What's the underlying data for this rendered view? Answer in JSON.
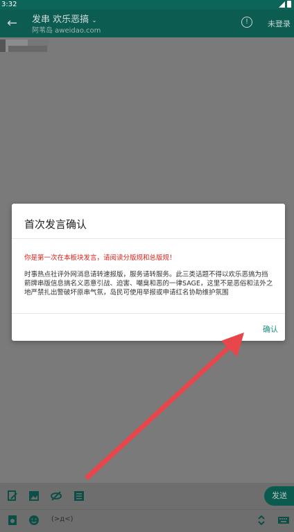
{
  "status_bar": {
    "time": "3:32"
  },
  "toolbar": {
    "title": "发串 欢乐恶搞",
    "subtitle": "阿苇岛 aweidao.com",
    "login_label": "未登录"
  },
  "dialog": {
    "title": "首次发言确认",
    "warning": "你是第一次在本板块发言，请阅读分版规和总版规！",
    "body": "时事热点社评外网消息请转速报版，服务请转服务。此三类话题不得以欢乐恶搞为挡箭牌串版信息搞名义恶意引战、迫害、嘲臭和恶的一律SAGE，这里不是恶俗和法外之地严禁扎出警破坏原串气氛，岛民可使用举报或申请红名协助维护氛围",
    "confirm_label": "确认"
  },
  "bottom": {
    "send_label": "发送",
    "kaomoji_label": "(>д<)"
  },
  "colors": {
    "statusbar": "#0d6458",
    "toolbar": "#0c5c51",
    "accent": "#1a8c7d",
    "warning": "#e0201a",
    "arrow": "#e8464a"
  },
  "icons": [
    "back-arrow-icon",
    "dropdown-chevron-icon",
    "info-icon",
    "edit-icon",
    "image-icon",
    "hide-eye-icon",
    "list-icon",
    "picture-icon",
    "emoji-icon",
    "expand-icon",
    "keyboard-icon"
  ]
}
